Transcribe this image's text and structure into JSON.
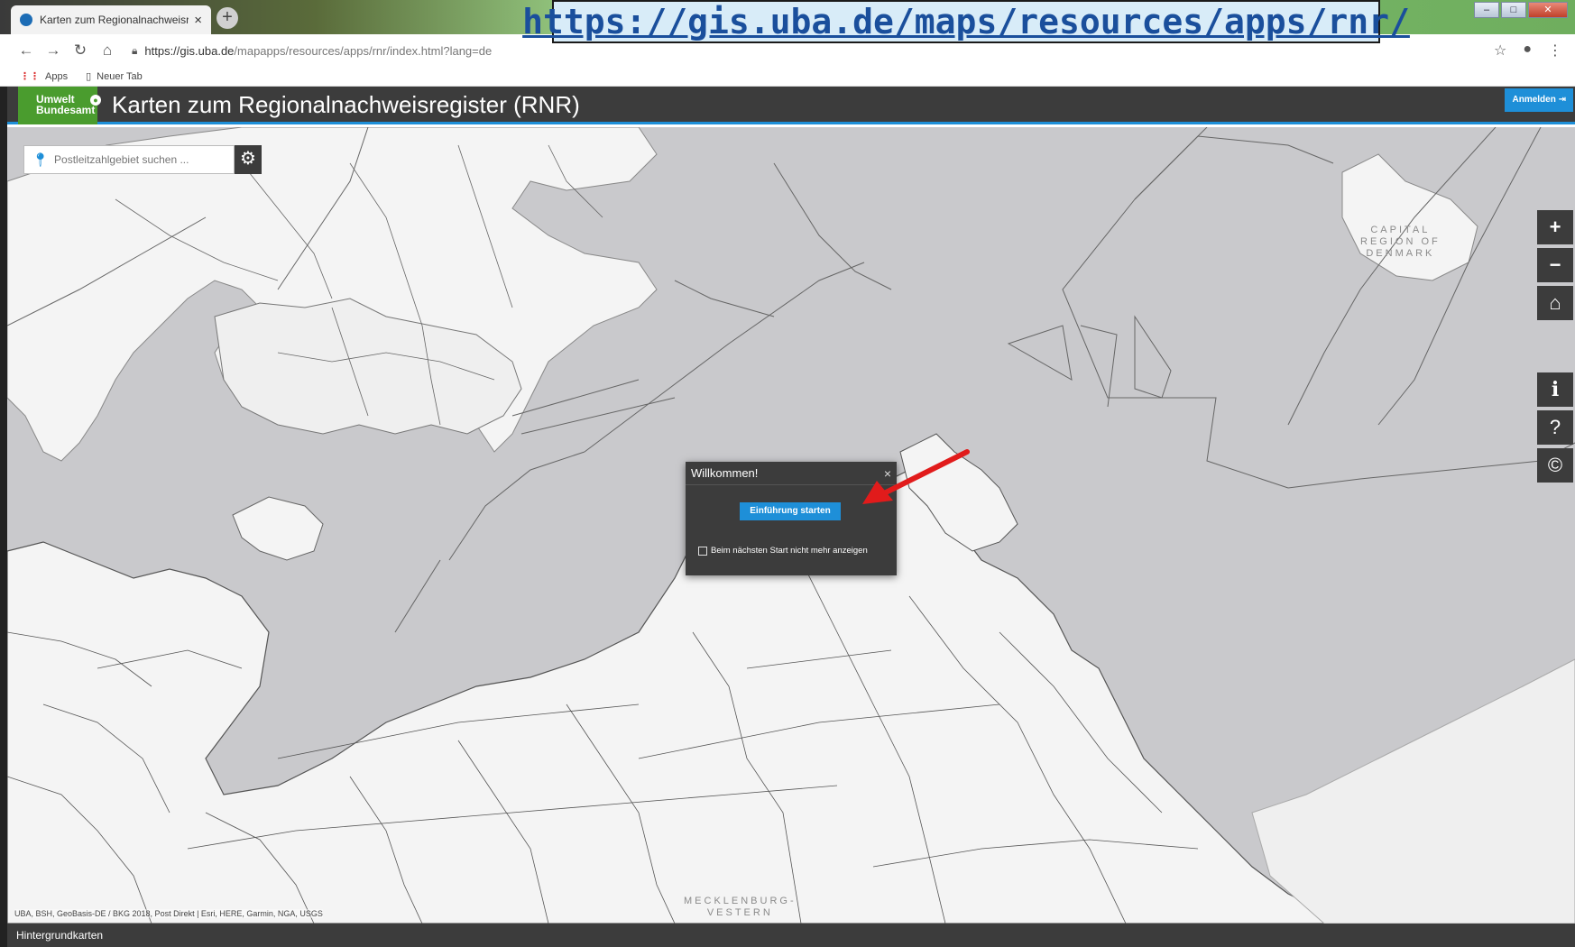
{
  "browser": {
    "tab_title": "Karten zum Regionalnachweisreg",
    "tab_close": "×",
    "new_tab": "+",
    "url_prefix": "https://gis.uba.de",
    "url_path": "/mapapps/resources/apps/rnr/index.html?lang=de",
    "bookmarks": [
      {
        "label": "Apps",
        "icon": "apps-grid-icon"
      },
      {
        "label": "Neuer Tab",
        "icon": "page-icon"
      }
    ]
  },
  "banner": {
    "url": "https://gis.uba.de/maps/resources/apps/rnr/"
  },
  "app": {
    "logo_line1": "Umwelt",
    "logo_line2": "Bundesamt",
    "title": "Karten zum Regionalnachweisregister (RNR)",
    "login_label": "Anmelden"
  },
  "search": {
    "placeholder": "Postleitzahlgebiet suchen ..."
  },
  "map": {
    "label_dk_1": "CAPITAL",
    "label_dk_2": "REGION OF",
    "label_dk_3": "DENMARK",
    "label_mv_1": "MECKLENBURG-",
    "label_mv_2": "VESTERN",
    "attribution": "UBA, BSH, GeoBasis-DE / BKG 2018, Post Direkt | Esri, HERE, Garmin, NGA, USGS"
  },
  "controls": {
    "zoom_in": "+",
    "zoom_out": "−",
    "info": "i",
    "help": "?",
    "copyright": "©"
  },
  "dialog": {
    "title": "Willkommen!",
    "close": "×",
    "start_button": "Einführung starten",
    "checkbox_label": "Beim nächsten Start nicht mehr anzeigen"
  },
  "footer": {
    "label": "Hintergrundkarten"
  },
  "colors": {
    "header_bg": "#3c3c3c",
    "accent_blue": "#1e8fd8",
    "brand_green": "#4a9c2e",
    "land": "#f4f4f4",
    "water": "#c9c9cc",
    "annotation_arrow": "#e11b1b"
  }
}
